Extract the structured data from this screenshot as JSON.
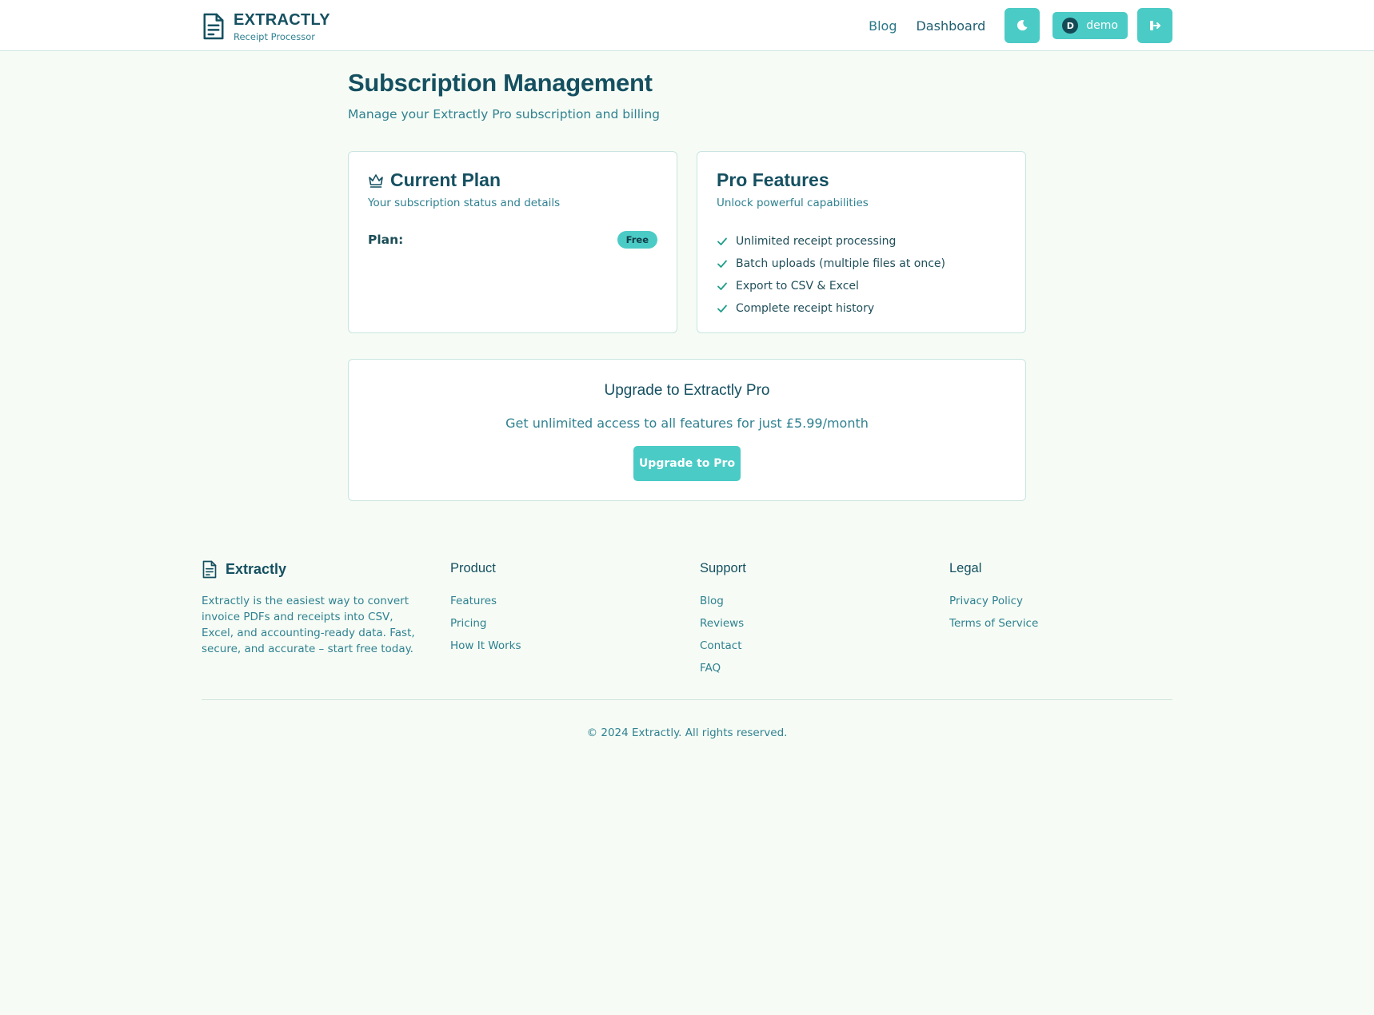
{
  "header": {
    "brand_name": "EXTRACTLY",
    "brand_tagline": "Receipt Processor",
    "nav": {
      "blog": "Blog",
      "dashboard": "Dashboard"
    },
    "user": {
      "initial": "D",
      "name": "demo"
    }
  },
  "main": {
    "title": "Subscription Management",
    "subtitle": "Manage your Extractly Pro subscription and billing",
    "current_plan": {
      "title": "Current Plan",
      "description": "Your subscription status and details",
      "plan_label": "Plan:",
      "plan_badge": "Free"
    },
    "pro_features": {
      "title": "Pro Features",
      "description": "Unlock powerful capabilities",
      "items": [
        "Unlimited receipt processing",
        "Batch uploads (multiple files at once)",
        "Export to CSV & Excel",
        "Complete receipt history"
      ]
    },
    "upgrade": {
      "title": "Upgrade to Extractly Pro",
      "description": "Get unlimited access to all features for just £5.99/month",
      "button": "Upgrade to Pro"
    }
  },
  "footer": {
    "brand_name": "Extractly",
    "description": "Extractly is the easiest way to convert invoice PDFs and receipts into CSV, Excel, and accounting-ready data. Fast, secure, and accurate – start free today.",
    "columns": {
      "product": {
        "title": "Product",
        "links": [
          "Features",
          "Pricing",
          "How It Works"
        ]
      },
      "support": {
        "title": "Support",
        "links": [
          "Blog",
          "Reviews",
          "Contact",
          "FAQ"
        ]
      },
      "legal": {
        "title": "Legal",
        "links": [
          "Privacy Policy",
          "Terms of Service"
        ]
      }
    },
    "copyright": "© 2024 Extractly. All rights reserved."
  },
  "colors": {
    "accent": "#4bcbc6",
    "primary_text": "#155061",
    "secondary_text": "#2f8191",
    "background": "#f6fcf5"
  },
  "icons": {
    "brand": "document-icon",
    "theme": "moon-icon",
    "logout": "logout-icon",
    "plan": "crown-icon",
    "feature": "check-icon"
  }
}
